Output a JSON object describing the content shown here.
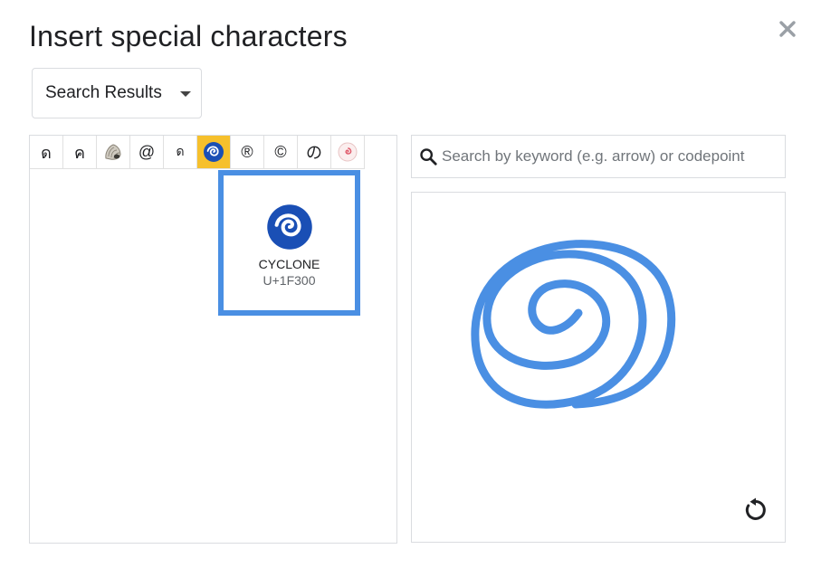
{
  "dialog": {
    "title": "Insert special characters",
    "close_icon": "close-icon"
  },
  "category_dropdown": {
    "selected": "Search Results",
    "caret_icon": "caret-down-icon"
  },
  "character_grid": {
    "cells": [
      {
        "glyph": "ด",
        "icon": null,
        "selected": false
      },
      {
        "glyph": "ค",
        "icon": null,
        "selected": false
      },
      {
        "glyph": "",
        "icon": "spiral-shell-icon",
        "selected": false
      },
      {
        "glyph": "@",
        "icon": null,
        "selected": false
      },
      {
        "glyph": "ด",
        "icon": null,
        "selected": false
      },
      {
        "glyph": "",
        "icon": "cyclone-icon",
        "selected": true
      },
      {
        "glyph": "®",
        "icon": null,
        "selected": false
      },
      {
        "glyph": "©",
        "icon": null,
        "selected": false
      },
      {
        "glyph": "の",
        "icon": null,
        "selected": false
      },
      {
        "glyph": "",
        "icon": "fish-cake-icon",
        "selected": false
      }
    ],
    "selected_color": "#f6c02c"
  },
  "preview": {
    "name": "CYCLONE",
    "codepoint": "U+1F300",
    "icon": "cyclone-icon",
    "border_color": "#4a8fe3"
  },
  "search": {
    "placeholder": "Search by keyword (e.g. arrow) or codepoint",
    "value": "",
    "icon": "search-icon"
  },
  "drawing_area": {
    "stroke_color": "#4a8fe3",
    "reset_icon": "reset-icon"
  }
}
